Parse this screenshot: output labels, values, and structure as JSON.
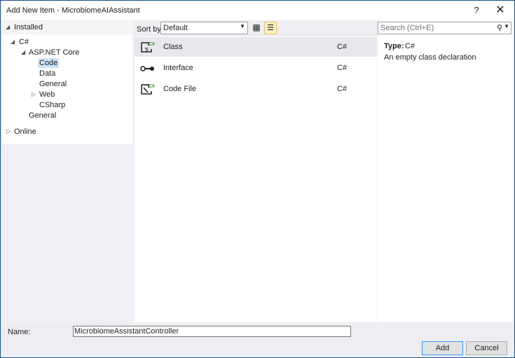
{
  "window": {
    "title": "Add New Item - MicrobiomeAIAssistant",
    "help": "?",
    "close": "✕"
  },
  "left": {
    "installed": "Installed",
    "tree": {
      "csharp": "C#",
      "aspnet": "ASP.NET Core",
      "code": "Code",
      "data": "Data",
      "general": "General",
      "web": "Web",
      "csharp2": "CSharp",
      "general2": "General"
    },
    "online": "Online"
  },
  "toolbar": {
    "sort_label": "Sort by:",
    "sort_value": "Default"
  },
  "templates": [
    {
      "name": "Class",
      "lang": "C#",
      "icon": "class-icon"
    },
    {
      "name": "Interface",
      "lang": "C#",
      "icon": "interface-icon"
    },
    {
      "name": "Code File",
      "lang": "C#",
      "icon": "code-file-icon"
    }
  ],
  "search": {
    "placeholder": "Search (Ctrl+E)"
  },
  "details": {
    "type_label": "Type:",
    "type_value": "C#",
    "description": "An empty class declaration"
  },
  "footer": {
    "name_label": "Name:",
    "name_value": "MicrobiomeAssistantController",
    "add": "Add",
    "cancel": "Cancel"
  },
  "colors": {
    "accent": "#3399ff",
    "selected": "#cce4f7",
    "csharp_green": "#388a34"
  }
}
